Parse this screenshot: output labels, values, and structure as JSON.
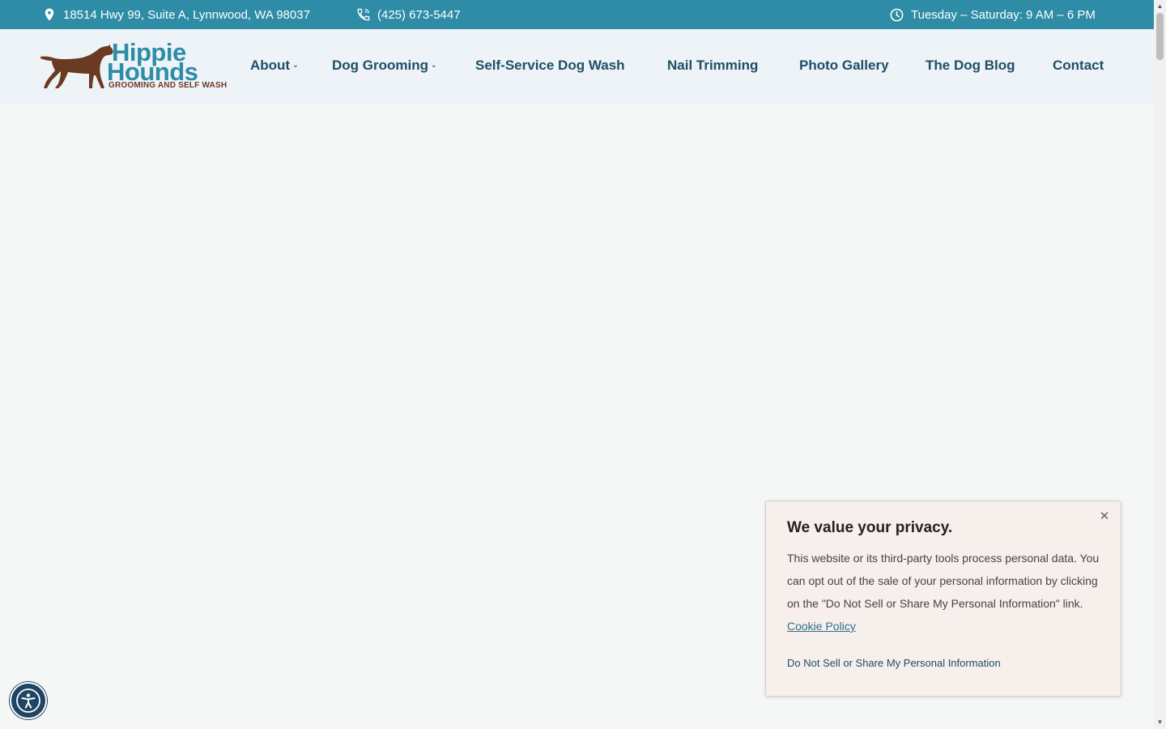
{
  "topbar": {
    "address": "18514 Hwy 99, Suite A, Lynnwood, WA 98037",
    "phone": "(425) 673-5447",
    "hours": "Tuesday – Saturday: 9 AM – 6 PM",
    "icons": {
      "address": "map-pin-icon",
      "phone": "phone-icon",
      "hours": "clock-icon"
    }
  },
  "logo": {
    "line1": "Hippie",
    "line2": "Hounds",
    "tagline": "GROOMING AND SELF WASH"
  },
  "nav": {
    "items": [
      {
        "label": "About",
        "has_dropdown": true
      },
      {
        "label": "Dog Grooming",
        "has_dropdown": true
      },
      {
        "label": "Self-Service Dog Wash",
        "has_dropdown": false
      },
      {
        "label": "Nail Trimming",
        "has_dropdown": false
      },
      {
        "label": "Photo Gallery",
        "has_dropdown": false
      },
      {
        "label": "The Dog Blog",
        "has_dropdown": false
      },
      {
        "label": "Contact",
        "has_dropdown": false
      }
    ],
    "dropdown_glyph": "⌄"
  },
  "privacy": {
    "title": "We value your privacy.",
    "body": "This website or its third-party tools process personal data. You can opt out of the sale of your personal information by clicking on the \"Do Not Sell or Share My Personal Information\" link.",
    "policy_link": "Cookie Policy",
    "dns_link": "Do Not Sell or Share My Personal Information",
    "close_glyph": "✕"
  },
  "scrollbar": {
    "up": "▲",
    "down": "▼"
  },
  "colors": {
    "topbar_bg": "#2e8ca6",
    "brand_blue": "#2e8ca6",
    "nav_text": "#1f4e66",
    "logo_brown": "#6b3a22",
    "accessibility_bg": "#1f4464"
  }
}
